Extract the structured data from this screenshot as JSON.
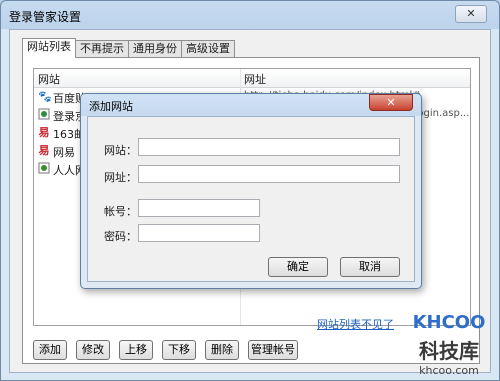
{
  "window": {
    "title": "登录管家设置",
    "close_label": "✕"
  },
  "tabs": [
    {
      "label": "网站列表"
    },
    {
      "label": "不再提示"
    },
    {
      "label": "通用身份"
    },
    {
      "label": "高级设置"
    }
  ],
  "list": {
    "columns": [
      "网站",
      "网址"
    ],
    "rows": [
      {
        "icon": "paw",
        "name": "百度贴吧",
        "url": "http://tieba.baidu.com/index.html#"
      },
      {
        "icon": "globe",
        "name": "登录京东",
        "url": "https://passport.360buy.com/new/login.asp..."
      },
      {
        "icon": "163",
        "name": "163邮箱",
        "url": ""
      },
      {
        "icon": "163",
        "name": "网易",
        "url": ""
      },
      {
        "icon": "doc",
        "name": "人人网",
        "url": ""
      }
    ]
  },
  "buttons": {
    "add": "添加",
    "edit": "修改",
    "up": "上移",
    "down": "下移",
    "delete": "删除",
    "manage_accounts": "管理帐号",
    "missing_link": "网站列表不见了"
  },
  "dialog": {
    "title": "添加网站",
    "close_label": "✕",
    "fields": {
      "site": {
        "label": "网站：",
        "value": ""
      },
      "url": {
        "label": "网址：",
        "value": ""
      },
      "account": {
        "label": "帐号：",
        "value": ""
      },
      "password": {
        "label": "密码：",
        "value": ""
      }
    },
    "ok": "确定",
    "cancel": "取消"
  },
  "watermark": {
    "logo": "KHCOO",
    "name": "科技库",
    "domain": "khcoo.com"
  }
}
